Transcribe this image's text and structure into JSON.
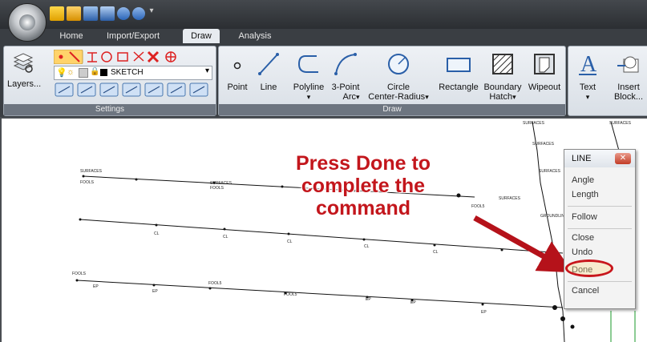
{
  "ribbon_tabs": [
    "Home",
    "Import/Export",
    "Draw",
    "Analysis"
  ],
  "active_tab": "Draw",
  "settings": {
    "layers_label": "Layers...",
    "layer_name": "SKETCH",
    "group_label": "Settings"
  },
  "draw": {
    "group_label": "Draw",
    "point": "Point",
    "line": "Line",
    "polyline": "Polyline",
    "arc": "3-Point Arc",
    "arc_line1": "3-Point",
    "arc_line2": "Arc",
    "circle_line1": "Circle",
    "circle_line2": "Center-Radius",
    "rectangle": "Rectangle",
    "hatch_line1": "Boundary",
    "hatch_line2": "Hatch",
    "wipeout": "Wipeout",
    "text": "Text",
    "insert_line1": "Insert",
    "insert_line2": "Block..."
  },
  "callout": {
    "line1": "Press Done to",
    "line2": "complete the",
    "line3": "command"
  },
  "context_menu": {
    "title": "LINE",
    "items": [
      "Angle",
      "Length",
      "Follow",
      "Close",
      "Undo",
      "Done",
      "Cancel"
    ],
    "highlighted": "Done"
  },
  "drawing_labels": {
    "surfaces": "SURFACES",
    "fools": "FOOLS",
    "cl": "CL",
    "ep": "EP",
    "groundlines": "GROUNDLINES",
    "fool5": "FOOL5"
  },
  "colors": {
    "accent_red": "#c3161c",
    "ribbon_dark": "#3a3e43"
  }
}
